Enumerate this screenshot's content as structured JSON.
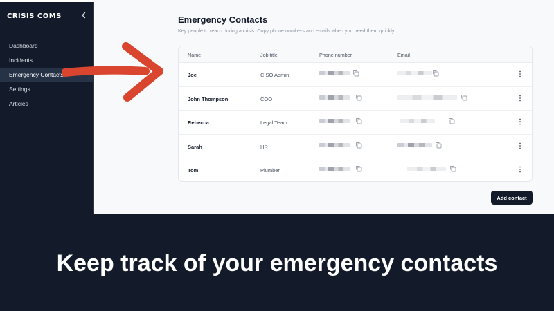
{
  "sidebar": {
    "brand": "CRISIS COMS",
    "items": [
      {
        "label": "Dashboard"
      },
      {
        "label": "Incidents"
      },
      {
        "label": "Emergency Contacts"
      },
      {
        "label": "Settings"
      },
      {
        "label": "Articles"
      }
    ],
    "active_item": "Emergency Contacts"
  },
  "main": {
    "title": "Emergency Contacts",
    "subtitle": "Key people to reach during a crisis. Copy phone numbers and emails when you need them quickly.",
    "table": {
      "columns": [
        "Name",
        "Job title",
        "Phone number",
        "Email"
      ],
      "rows": [
        {
          "name": "Joe",
          "job_title": "CISO Admin"
        },
        {
          "name": "John Thompson",
          "job_title": "COO"
        },
        {
          "name": "Rebecca",
          "job_title": "Legal Team"
        },
        {
          "name": "Sarah",
          "job_title": "HR"
        },
        {
          "name": "Tom",
          "job_title": "Plumber"
        }
      ]
    },
    "add_button_label": "Add contact"
  },
  "caption": "Keep track of your emergency contacts",
  "colors": {
    "sidebar_bg": "#131b2b",
    "arrow": "#d9452f",
    "button_bg": "#131b2b"
  },
  "icons": [
    "chevron-left-icon",
    "copy-icon",
    "kebab-menu-icon",
    "arrow-annotation"
  ]
}
